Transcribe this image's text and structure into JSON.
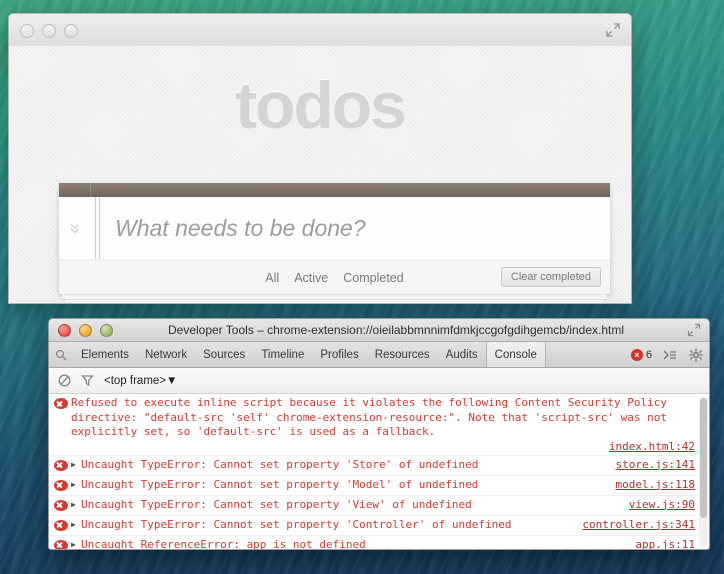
{
  "desktop": {
    "wallpaper_name": "ocean-wave-wallpaper"
  },
  "browser_window": {
    "traffic_lights": [
      "close",
      "minimize",
      "zoom"
    ],
    "expand_icon": "expand-arrows-icon"
  },
  "todoapp": {
    "title": "todos",
    "toggle_all_icon": "chevron-toggle-all-icon",
    "new_todo_placeholder": "What needs to be done?",
    "new_todo_value": "",
    "filters": [
      "All",
      "Active",
      "Completed"
    ],
    "clear_completed_label": "Clear completed"
  },
  "devtools": {
    "window_title": "Developer Tools – chrome-extension://oieilabbmnnimfdmkjccgofgdihgemcb/index.html",
    "traffic_lights": [
      "close",
      "minimize",
      "zoom"
    ],
    "resize_icon": "resize-arrows-icon",
    "search_icon": "search-icon",
    "tabs": [
      "Elements",
      "Network",
      "Sources",
      "Timeline",
      "Profiles",
      "Resources",
      "Audits",
      "Console"
    ],
    "active_tab": "Console",
    "error_count": "6",
    "error_badge_icon": "error-circle-icon",
    "drawer_icon": "console-drawer-icon",
    "settings_icon": "gear-icon",
    "filterbar": {
      "clear_icon": "clear-console-icon",
      "filter_icon": "filter-funnel-icon",
      "frame_selector": "<top frame>",
      "frame_selector_caret": "▼"
    },
    "console_messages": [
      {
        "level": "error",
        "icon": "error-circle-icon",
        "expandable": false,
        "text": "Refused to execute inline script because it violates the following Content Security Policy directive: \"default-src 'self' chrome-extension-resource:\". Note that 'script-src' was not explicitly set, so 'default-src' is used as a fallback.",
        "source": "index.html:42",
        "source_below": true
      },
      {
        "level": "error",
        "icon": "error-circle-icon",
        "expandable": true,
        "disclosure": "▶",
        "text": "Uncaught TypeError: Cannot set property 'Store' of undefined",
        "source": "store.js:141",
        "source_below": false
      },
      {
        "level": "error",
        "icon": "error-circle-icon",
        "expandable": true,
        "disclosure": "▶",
        "text": "Uncaught TypeError: Cannot set property 'Model' of undefined",
        "source": "model.js:118",
        "source_below": false
      },
      {
        "level": "error",
        "icon": "error-circle-icon",
        "expandable": true,
        "disclosure": "▶",
        "text": "Uncaught TypeError: Cannot set property 'View' of undefined",
        "source": "view.js:90",
        "source_below": false
      },
      {
        "level": "error",
        "icon": "error-circle-icon",
        "expandable": true,
        "disclosure": "▶",
        "text": "Uncaught TypeError: Cannot set property 'Controller' of undefined",
        "source": "controller.js:341",
        "source_below": false
      },
      {
        "level": "error",
        "icon": "error-circle-icon",
        "expandable": true,
        "disclosure": "▶",
        "text": "Uncaught ReferenceError: app is not defined",
        "source": "app.js:11",
        "source_below": false
      }
    ],
    "prompt": {
      "arrow": ">",
      "value": ""
    }
  },
  "colors": {
    "error_red": "#d23b32",
    "error_badge": "#d93025",
    "link_red": "#b03030",
    "prompt_blue": "#5a7fdc",
    "todo_title_gray": "#d4d4d4",
    "todo_topbar": "#7d7167"
  }
}
